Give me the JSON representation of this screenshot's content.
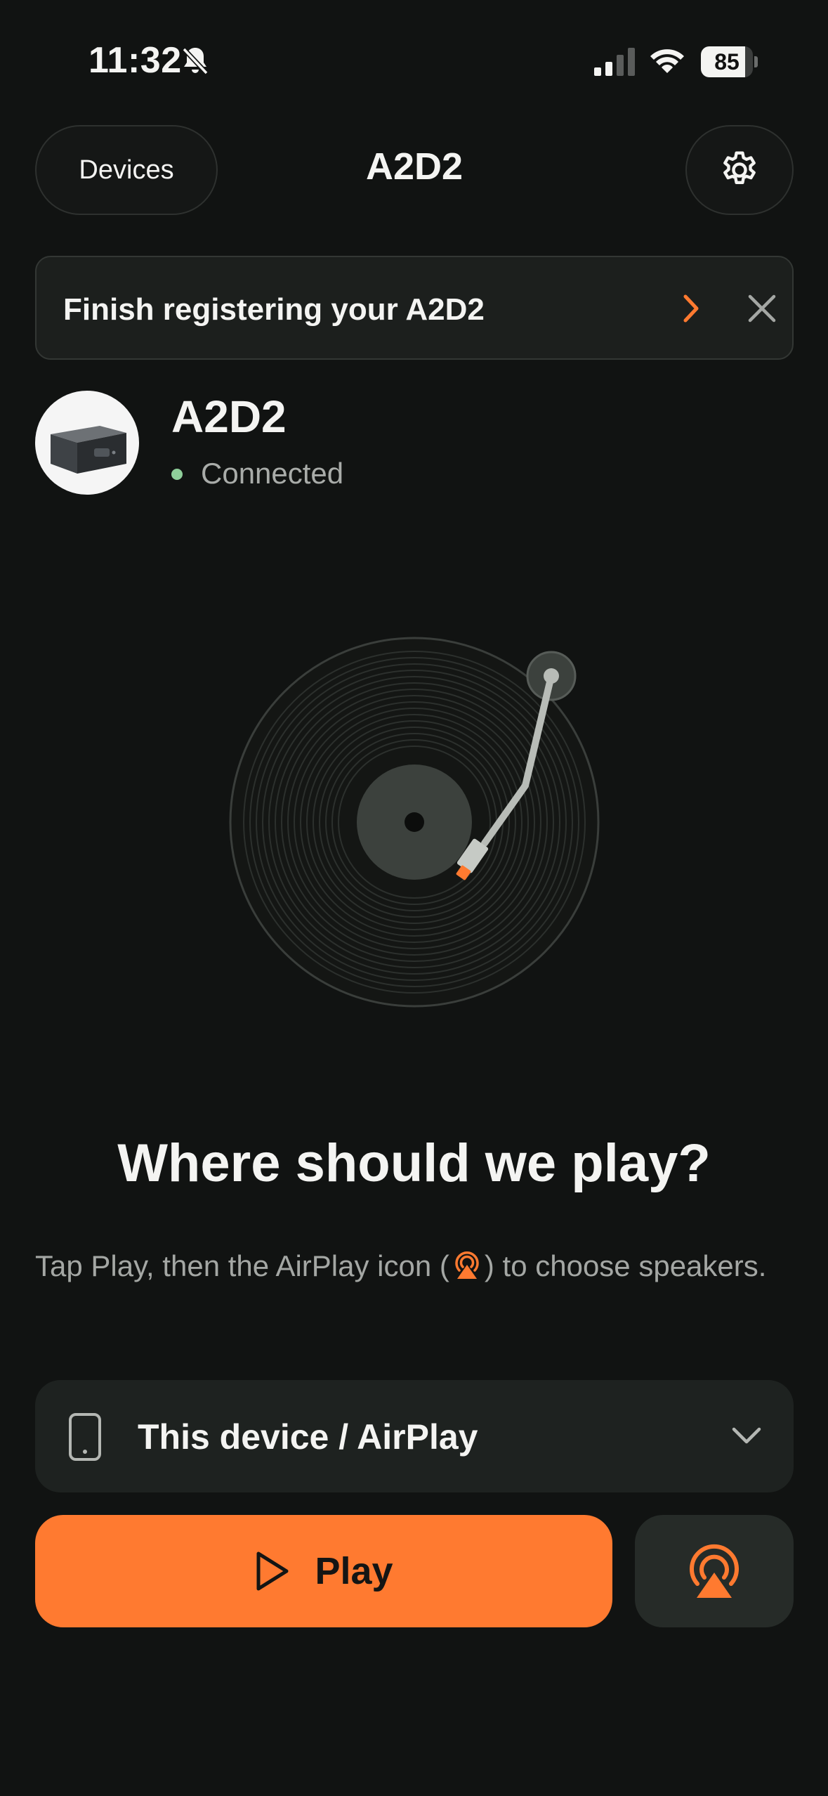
{
  "status_bar": {
    "time": "11:32",
    "battery_percent": "85",
    "battery_level": 0.85,
    "icons": [
      "bell-slash-icon",
      "cellular-signal-icon",
      "wifi-icon",
      "battery-icon"
    ]
  },
  "header": {
    "devices_label": "Devices",
    "title": "A2D2",
    "settings_icon": "gear-icon"
  },
  "banner": {
    "text": "Finish registering your A2D2",
    "chevron_icon": "chevron-right-icon",
    "close_icon": "close-icon"
  },
  "device": {
    "name": "A2D2",
    "status": "Connected"
  },
  "main": {
    "heading": "Where should we play?",
    "instruction_before": "Tap Play, then the AirPlay icon (",
    "instruction_after": ") to choose speakers."
  },
  "output_selector": {
    "label": "This device / AirPlay"
  },
  "actions": {
    "play_label": "Play"
  },
  "colors": {
    "background": "#111312",
    "accent": "#ff7a30",
    "connected": "#8fcf9a",
    "card": "#1e2220"
  }
}
